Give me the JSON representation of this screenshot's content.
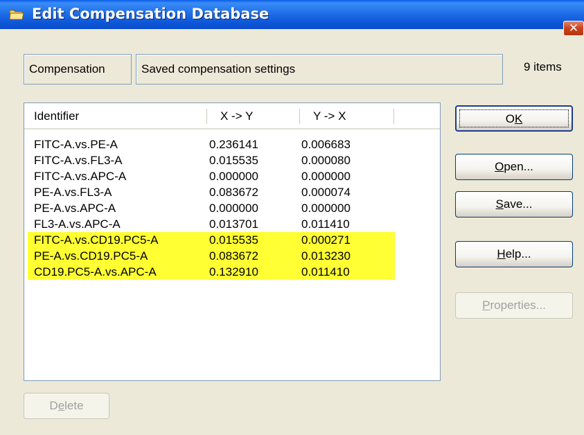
{
  "window": {
    "title": "Edit Compensation Database",
    "close_glyph": "✕"
  },
  "header": {
    "compensation_label": "Compensation",
    "description": "Saved compensation settings",
    "item_count": "9 items"
  },
  "list": {
    "columns": [
      "Identifier",
      "X -> Y",
      "Y -> X"
    ],
    "rows": [
      {
        "id": "FITC-A.vs.PE-A",
        "xy": "0.236141",
        "yx": "0.006683",
        "highlight": false
      },
      {
        "id": "FITC-A.vs.FL3-A",
        "xy": "0.015535",
        "yx": "0.000080",
        "highlight": false
      },
      {
        "id": "FITC-A.vs.APC-A",
        "xy": "0.000000",
        "yx": "0.000000",
        "highlight": false
      },
      {
        "id": "PE-A.vs.FL3-A",
        "xy": "0.083672",
        "yx": "0.000074",
        "highlight": false
      },
      {
        "id": "PE-A.vs.APC-A",
        "xy": "0.000000",
        "yx": "0.000000",
        "highlight": false
      },
      {
        "id": "FL3-A.vs.APC-A",
        "xy": "0.013701",
        "yx": "0.011410",
        "highlight": false
      },
      {
        "id": "FITC-A.vs.CD19.PC5-A",
        "xy": "0.015535",
        "yx": "0.000271",
        "highlight": true
      },
      {
        "id": "PE-A.vs.CD19.PC5-A",
        "xy": "0.083672",
        "yx": "0.013230",
        "highlight": true
      },
      {
        "id": "CD19.PC5-A.vs.APC-A",
        "xy": "0.132910",
        "yx": "0.011410",
        "highlight": true
      }
    ],
    "highlight_color": "#ffff33"
  },
  "buttons": {
    "ok": {
      "label": "OK",
      "accel": "K"
    },
    "open": {
      "label": "Open...",
      "accel": "O"
    },
    "save": {
      "label": "Save...",
      "accel": "S"
    },
    "help": {
      "label": "Help...",
      "accel": "H"
    },
    "properties": {
      "label": "Properties...",
      "accel": "P"
    },
    "delete": {
      "label": "Delete",
      "accel": "e"
    }
  },
  "icons": {
    "title": "folder-icon",
    "close": "close-icon"
  }
}
